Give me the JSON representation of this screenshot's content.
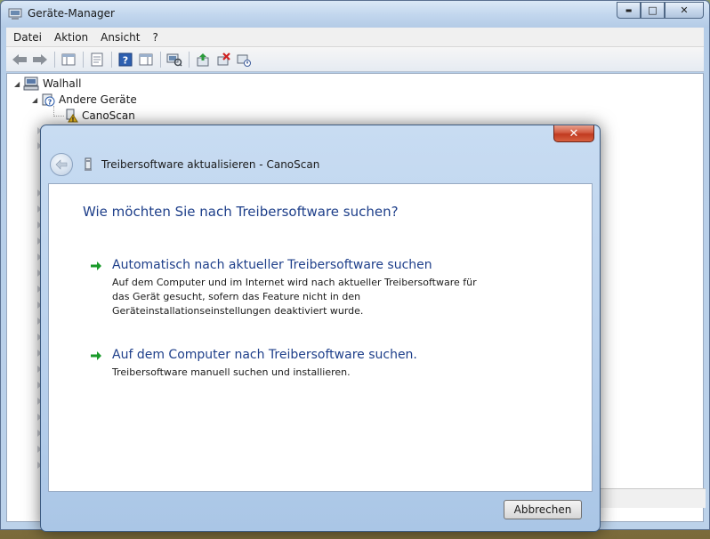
{
  "window": {
    "title": "Geräte-Manager",
    "caption": {
      "minimize": "▬",
      "maximize": "□",
      "close": "✕"
    }
  },
  "menu": {
    "items": [
      "Datei",
      "Aktion",
      "Ansicht",
      "?"
    ]
  },
  "toolbar": {
    "icons": [
      "back-icon",
      "forward-icon",
      "show-hide-console-tree-icon",
      "properties-icon",
      "help-icon",
      "show-action-pane-icon",
      "scan-hardware-icon",
      "update-driver-icon",
      "uninstall-icon",
      "disable-device-icon"
    ]
  },
  "tree": {
    "root": "Walhall",
    "group": "Andere Geräte",
    "device": "CanoScan"
  },
  "wizard": {
    "title": "Treibersoftware aktualisieren - CanoScan",
    "close": "✕",
    "question": "Wie möchten Sie nach Treibersoftware suchen?",
    "options": [
      {
        "title": "Automatisch nach aktueller Treibersoftware suchen",
        "desc": "Auf dem Computer und im Internet wird nach aktueller Treibersoftware für das Gerät gesucht, sofern das Feature nicht in den Geräteinstallationseinstellungen deaktiviert wurde."
      },
      {
        "title": "Auf dem Computer nach Treibersoftware suchen.",
        "desc": "Treibersoftware manuell suchen und installieren."
      }
    ],
    "cancel": "Abbrechen"
  },
  "colors": {
    "link_blue": "#1e3f8a",
    "arrow_green": "#1a9a2a"
  }
}
